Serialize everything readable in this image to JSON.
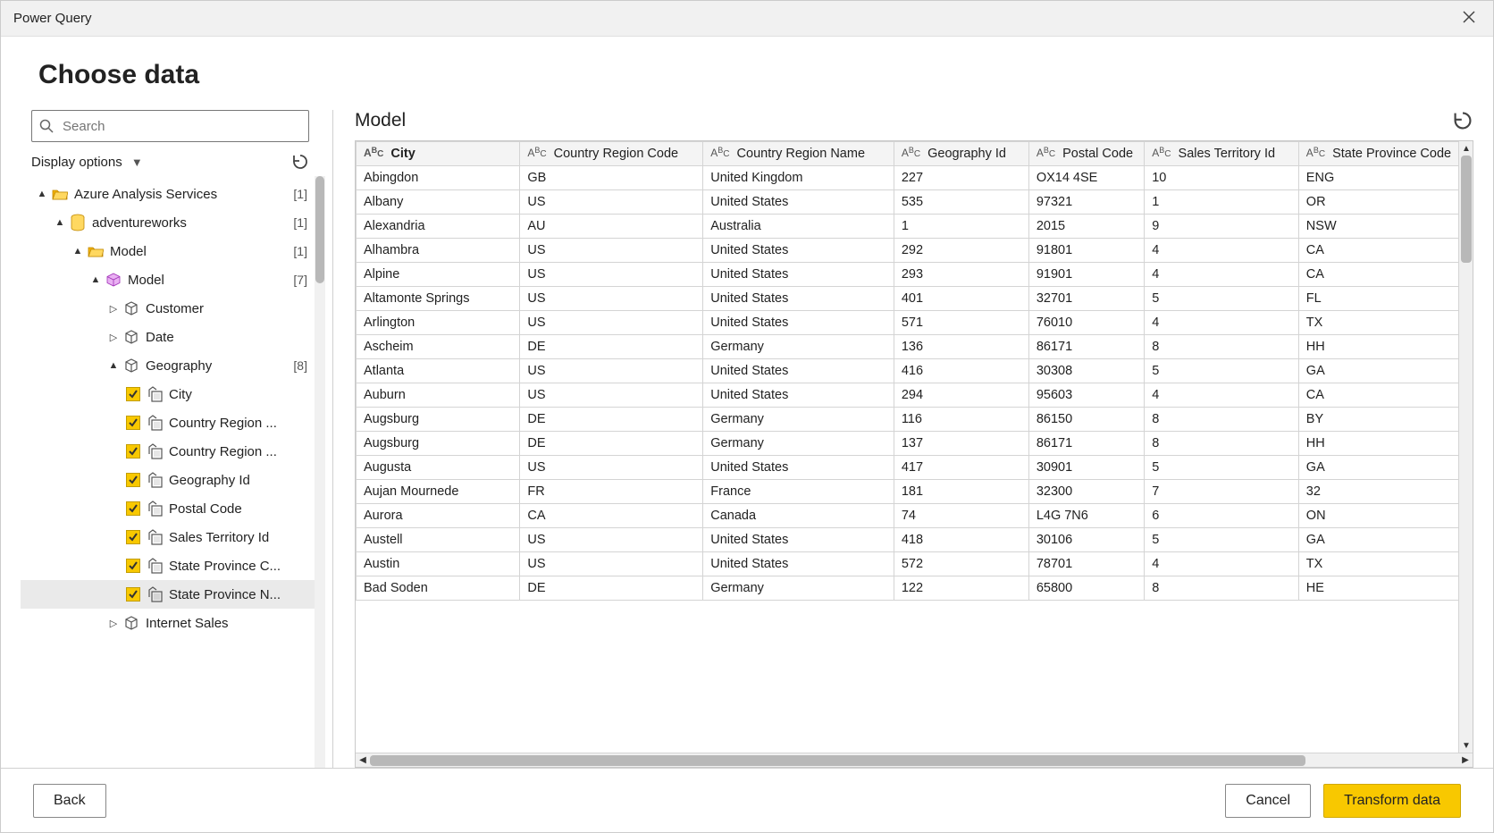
{
  "window": {
    "title": "Power Query"
  },
  "page": {
    "heading": "Choose data"
  },
  "search": {
    "placeholder": "Search"
  },
  "display_options_label": "Display options",
  "tree": {
    "root": {
      "label": "Azure Analysis Services",
      "count": "[1]"
    },
    "database": {
      "label": "adventureworks",
      "count": "[1]"
    },
    "folder": {
      "label": "Model",
      "count": "[1]"
    },
    "cube": {
      "label": "Model",
      "count": "[7]"
    },
    "customer": {
      "label": "Customer"
    },
    "date": {
      "label": "Date"
    },
    "geography": {
      "label": "Geography",
      "count": "[8]"
    },
    "internet_sales": {
      "label": "Internet Sales"
    },
    "geo_children": [
      {
        "label": "City"
      },
      {
        "label": "Country Region ..."
      },
      {
        "label": "Country Region ..."
      },
      {
        "label": "Geography Id"
      },
      {
        "label": "Postal Code"
      },
      {
        "label": "Sales Territory Id"
      },
      {
        "label": "State Province C..."
      },
      {
        "label": "State Province N..."
      }
    ]
  },
  "preview": {
    "title": "Model",
    "columns": [
      "City",
      "Country Region Code",
      "Country Region Name",
      "Geography Id",
      "Postal Code",
      "Sales Territory Id",
      "State Province Code"
    ],
    "rows": [
      [
        "Abingdon",
        "GB",
        "United Kingdom",
        "227",
        "OX14 4SE",
        "10",
        "ENG"
      ],
      [
        "Albany",
        "US",
        "United States",
        "535",
        "97321",
        "1",
        "OR"
      ],
      [
        "Alexandria",
        "AU",
        "Australia",
        "1",
        "2015",
        "9",
        "NSW"
      ],
      [
        "Alhambra",
        "US",
        "United States",
        "292",
        "91801",
        "4",
        "CA"
      ],
      [
        "Alpine",
        "US",
        "United States",
        "293",
        "91901",
        "4",
        "CA"
      ],
      [
        "Altamonte Springs",
        "US",
        "United States",
        "401",
        "32701",
        "5",
        "FL"
      ],
      [
        "Arlington",
        "US",
        "United States",
        "571",
        "76010",
        "4",
        "TX"
      ],
      [
        "Ascheim",
        "DE",
        "Germany",
        "136",
        "86171",
        "8",
        "HH"
      ],
      [
        "Atlanta",
        "US",
        "United States",
        "416",
        "30308",
        "5",
        "GA"
      ],
      [
        "Auburn",
        "US",
        "United States",
        "294",
        "95603",
        "4",
        "CA"
      ],
      [
        "Augsburg",
        "DE",
        "Germany",
        "116",
        "86150",
        "8",
        "BY"
      ],
      [
        "Augsburg",
        "DE",
        "Germany",
        "137",
        "86171",
        "8",
        "HH"
      ],
      [
        "Augusta",
        "US",
        "United States",
        "417",
        "30901",
        "5",
        "GA"
      ],
      [
        "Aujan Mournede",
        "FR",
        "France",
        "181",
        "32300",
        "7",
        "32"
      ],
      [
        "Aurora",
        "CA",
        "Canada",
        "74",
        "L4G 7N6",
        "6",
        "ON"
      ],
      [
        "Austell",
        "US",
        "United States",
        "418",
        "30106",
        "5",
        "GA"
      ],
      [
        "Austin",
        "US",
        "United States",
        "572",
        "78701",
        "4",
        "TX"
      ],
      [
        "Bad Soden",
        "DE",
        "Germany",
        "122",
        "65800",
        "8",
        "HE"
      ]
    ]
  },
  "footer": {
    "back": "Back",
    "cancel": "Cancel",
    "transform": "Transform data"
  }
}
